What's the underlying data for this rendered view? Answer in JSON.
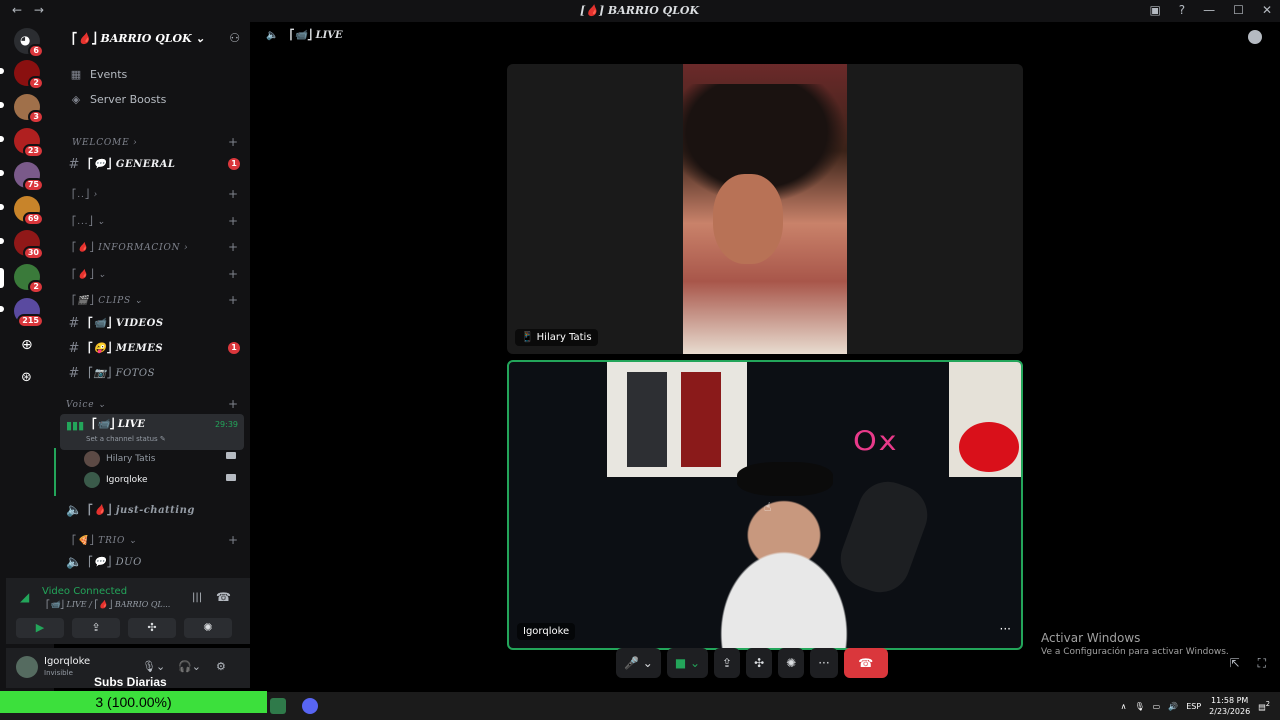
{
  "titlebar": {
    "back": "←",
    "forward": "→",
    "title": "⎡🩸⎦ 𝘽𝘼𝙍𝙍𝙄𝙊 𝙌𝙇𝙊𝙆",
    "title_plain": "[🩸] BARRIO QLOK",
    "buttons": [
      "▣",
      "?",
      "—",
      "☐",
      "✕"
    ]
  },
  "servers": {
    "items": [
      {
        "badge": "6"
      },
      {
        "badge": "2"
      },
      {
        "badge": "3"
      },
      {
        "badge": "23"
      },
      {
        "badge": "75"
      },
      {
        "badge": "69"
      },
      {
        "badge": "30"
      },
      {
        "badge": "2"
      },
      {
        "badge": "215"
      }
    ]
  },
  "guild": {
    "name": "⎡🩸⎦ BARRIO QLOK ⌄",
    "top_links": [
      {
        "label": "Events",
        "icon": "calendar-icon"
      },
      {
        "label": "Server Boosts",
        "icon": "boost-icon"
      }
    ]
  },
  "channels": {
    "welcome": "WELCOME ›",
    "general": "⎡💬⎦ GENERAL",
    "general_badge": "1",
    "cat_blank1": "⎡..⎦ ›",
    "cat_blank2": "⎡...⎦ ⌄",
    "informacion": "⎡🩸⎦ INFORMACION ›",
    "cat_drop": "⎡🩸⎦ ⌄",
    "clips": "⎡🎬⎦ CLIPS ⌄",
    "videos": "⎡📹⎦ VIDEOS",
    "memes": "⎡😜⎦ MEMES",
    "memes_badge": "1",
    "fotos": "⎡📷⎦ FOTOS",
    "voice_cat": "Voice ⌄",
    "live": "⎡📹⎦ LIVE",
    "live_time": "29:39",
    "live_status": "Set a channel status ✎",
    "voice_users": [
      "Hilary Tatis",
      "Igorqloke"
    ],
    "just_chatting": "⎡🩸⎦ just-chatting",
    "trio": "⎡🍕⎦ TRIO ⌄",
    "duo": "⎡💬⎦ DUO"
  },
  "voice_panel": {
    "title": "Video Connected",
    "subtitle": "⎡📹⎦ LIVE / ⎡🩸⎦ BARRIO QL...",
    "buttons": [
      "▶",
      "⇪",
      "✣",
      "✺"
    ]
  },
  "user": {
    "name": "Igorqloke",
    "status": "Invisible"
  },
  "overlay": {
    "subs_label": "Subs Diarias",
    "progress_text": "3 (100.00%)",
    "progress_fraction": 1.0
  },
  "main": {
    "channel_header": "⎡📹⎦ LIVE",
    "tile1_label": "Hilary Tatis",
    "tile2_label": "Igorqloke",
    "controls": [
      "🎤 ⌄",
      "■ ⌄",
      "⇪",
      "✣",
      "✺",
      "···"
    ],
    "hangup": "☎"
  },
  "windows_notice": {
    "title": "Activar Windows",
    "body": "Ve a Configuración para activar Windows."
  },
  "taskbar": {
    "lang": "ESP",
    "time": "11:58 PM",
    "date": "2/23/2026",
    "notifications": "2"
  },
  "colors": {
    "accent_green": "#23a55a",
    "hangup_red": "#da373c",
    "progress_green": "#3ce03c"
  }
}
